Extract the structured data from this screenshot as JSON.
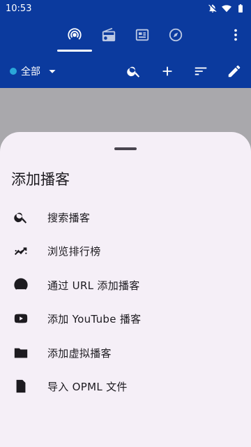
{
  "status_bar": {
    "time": "10:53"
  },
  "tabs": [
    {
      "name": "podcasts-tab",
      "icon": "podcast-icon",
      "selected": true
    },
    {
      "name": "radio-tab",
      "icon": "radio-icon",
      "selected": false
    },
    {
      "name": "news-tab",
      "icon": "newspaper-icon",
      "selected": false
    },
    {
      "name": "explore-tab",
      "icon": "compass-icon",
      "selected": false
    }
  ],
  "toolbar": {
    "filter_label": "全部",
    "actions": [
      "search-icon",
      "add-icon",
      "sort-icon",
      "edit-icon"
    ]
  },
  "sheet": {
    "title": "添加播客",
    "items": [
      {
        "icon": "search-icon",
        "label": "搜索播客"
      },
      {
        "icon": "trending-icon",
        "label": "浏览排行榜"
      },
      {
        "icon": "podcast-icon",
        "label": "通过 URL 添加播客"
      },
      {
        "icon": "youtube-icon",
        "label": "添加 YouTube 播客"
      },
      {
        "icon": "folder-add-icon",
        "label": "添加虚拟播客"
      },
      {
        "icon": "file-code-icon",
        "label": "导入 OPML 文件"
      }
    ]
  },
  "colors": {
    "app_bar": "#0b3a9e",
    "scrim": "#a9a8ac",
    "sheet_bg": "#f5eff7",
    "filter_dot": "#2aa7d9"
  }
}
